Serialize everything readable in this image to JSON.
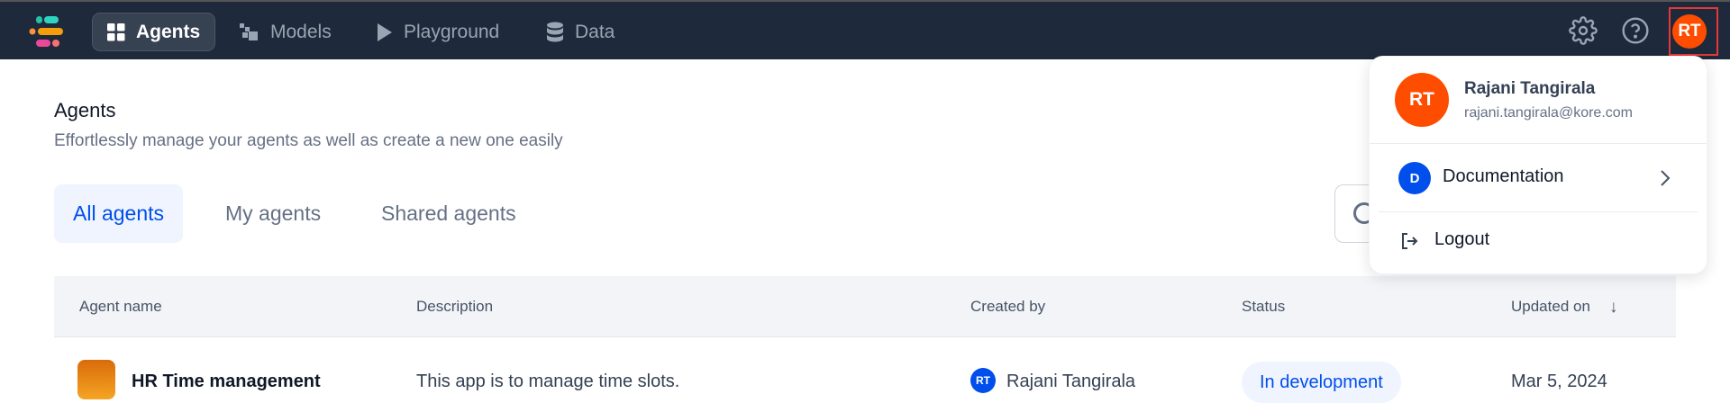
{
  "nav": {
    "items": [
      {
        "label": "Agents",
        "icon": "grid-icon",
        "active": true
      },
      {
        "label": "Models",
        "icon": "models-icon",
        "active": false
      },
      {
        "label": "Playground",
        "icon": "play-icon",
        "active": false
      },
      {
        "label": "Data",
        "icon": "database-icon",
        "active": false
      }
    ],
    "avatar_initials": "RT"
  },
  "page": {
    "title": "Agents",
    "subtitle": "Effortlessly manage your agents as well as create a new one easily"
  },
  "tabs": [
    {
      "label": "All agents",
      "active": true
    },
    {
      "label": "My agents",
      "active": false
    },
    {
      "label": "Shared agents",
      "active": false
    }
  ],
  "table": {
    "headers": [
      "Agent name",
      "Description",
      "Created by",
      "Status",
      "Updated on"
    ],
    "rows": [
      {
        "name": "HR Time management",
        "description": "This app is to manage time slots.",
        "creator_initials": "RT",
        "creator": "Rajani Tangirala",
        "status": "In development",
        "updated": "Mar 5, 2024"
      }
    ]
  },
  "user_menu": {
    "initials": "RT",
    "name": "Rajani Tangirala",
    "email": "rajani.tangirala@kore.com",
    "documentation_initial": "D",
    "documentation_label": "Documentation",
    "logout_label": "Logout"
  },
  "colors": {
    "nav_bg": "#1e293b",
    "accent": "#004eeb",
    "avatar": "#ff4d00",
    "highlight": "#e53935"
  }
}
